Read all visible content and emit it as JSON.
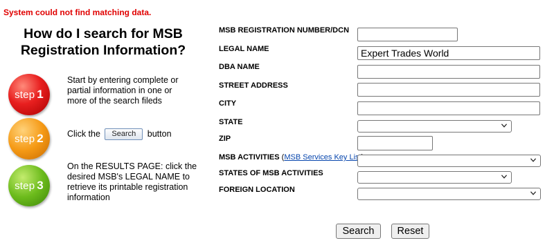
{
  "error_message": "System could not find matching data.",
  "help": {
    "title_line1": "How do I search for MSB",
    "title_line2": "Registration Information?",
    "steps": [
      {
        "word": "step",
        "num": "1",
        "color": "#e81f1f",
        "text": "Start by entering complete or partial information in one or more of the search fileds"
      },
      {
        "word": "step",
        "num": "2",
        "color": "#f59a16",
        "text_before": "Click the",
        "inline_button": "Search",
        "text_after": "button"
      },
      {
        "word": "step",
        "num": "3",
        "color": "#6cbb1c",
        "text": "On the RESULTS PAGE: click the desired MSB's LEGAL NAME to retrieve its printable registration information"
      }
    ]
  },
  "form": {
    "registration_number": {
      "label": "MSB REGISTRATION NUMBER/DCN",
      "value": ""
    },
    "legal_name": {
      "label": "LEGAL NAME",
      "value": "Expert Trades World"
    },
    "dba_name": {
      "label": "DBA NAME",
      "value": ""
    },
    "street_address": {
      "label": "STREET ADDRESS",
      "value": ""
    },
    "city": {
      "label": "CITY",
      "value": ""
    },
    "state": {
      "label": "STATE",
      "selected": ""
    },
    "zip": {
      "label": "ZIP",
      "value": ""
    },
    "msb_activities": {
      "label": "MSB ACTIVITIES",
      "paren_open": "(",
      "link": "MSB Services Key List",
      "paren_close": ")",
      "selected": ""
    },
    "states_of_msb_activities": {
      "label": "STATES OF MSB ACTIVITIES",
      "selected": ""
    },
    "foreign_location": {
      "label": "FOREIGN LOCATION",
      "selected": ""
    }
  },
  "buttons": {
    "search": "Search",
    "reset": "Reset"
  },
  "icons": {
    "dropdown": "chevron-down-icon"
  }
}
